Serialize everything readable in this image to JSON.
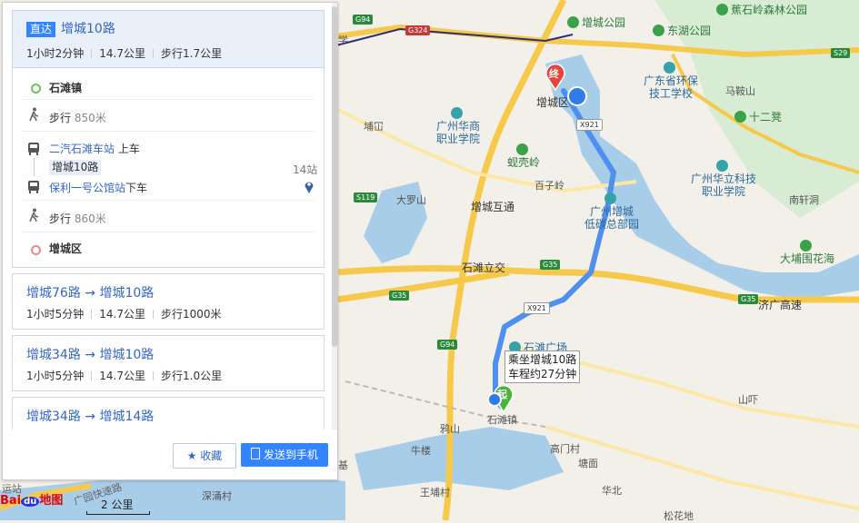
{
  "route_panel": {
    "active_route": {
      "badge": "直达",
      "name": "增城10路",
      "duration": "1小时2分钟",
      "distance": "14.7公里",
      "walk": "步行1.7公里",
      "steps": {
        "origin": "石滩镇",
        "walk1_label": "步行",
        "walk1_dist": "850米",
        "board_stop": "二汽石滩车站",
        "board_action": "上车",
        "line_tag": "增城10路",
        "stop_count": "14站",
        "alight_stop": "保利一号公馆站",
        "alight_action": "下车",
        "walk2_label": "步行",
        "walk2_dist": "860米",
        "destination": "增城区"
      }
    },
    "alternatives": [
      {
        "name": "增城76路 → 增城10路",
        "duration": "1小时5分钟",
        "distance": "14.7公里",
        "walk": "步行1000米"
      },
      {
        "name": "增城34路 → 增城10路",
        "duration": "1小时5分钟",
        "distance": "14.7公里",
        "walk": "步行1.0公里"
      },
      {
        "name": "增城34路 → 增城14路",
        "duration": "",
        "distance": "",
        "walk": ""
      }
    ],
    "buttons": {
      "favorite": "收藏",
      "send_to_phone": "发送到手机"
    }
  },
  "map": {
    "logo": "Bai du 地图",
    "scale_label": "2 公里",
    "route_tooltip": {
      "line1": "乘坐增城10路",
      "line2": "车程约27分钟"
    },
    "start_marker": "起",
    "end_marker": "终",
    "route_color": "#4f8ff0",
    "pois": {
      "forest_park": "蕉石岭森林公园",
      "zengcheng_park": "增城公园",
      "donghu_park": "东湖公园",
      "env_school_1": "广东省环保",
      "env_school_2": "技工学校",
      "huashang_1": "广州华商",
      "huashang_2": "职业学院",
      "xianke": "蚬壳岭",
      "lowcarbon_1": "广州增城",
      "lowcarbon_2": "低碳总部园",
      "huali_1": "广州华立科技",
      "huali_2": "职业学院",
      "shiergeng": "十二凳",
      "dapuwei": "大埔围花海",
      "shitan_square": "石滩广场"
    },
    "labels": {
      "zengcheng_qu": "增城区",
      "mayanshan": "马鞍山",
      "bugang": "埔冚",
      "baiziling": "百子岭",
      "daluoshan": "大罗山",
      "nanxuandong": "南轩洞",
      "zengcheng_interchange": "增城互通",
      "shitan_interchange": "石滩立交",
      "jiguang_expressway": "济广高速",
      "shanpu": "山吓",
      "gangbian": "鸦山",
      "shitan_town": "石滩镇",
      "niulou": "牛楼",
      "gaomencun": "高门村",
      "tangmian": "塘面",
      "wangpucun": "王埔村",
      "shencongcun": "深涌村",
      "huabei": "华北",
      "songcun": "松花地",
      "ji": "基",
      "guangzhou_expressway": "广园快速路",
      "yunzhan": "运站",
      "xue": "学"
    },
    "shields": {
      "g94_top": "G94",
      "g324": "G324",
      "x921_top": "X921",
      "s29": "S29",
      "s119": "S119",
      "g35_mid": "G35",
      "g35_left": "G35",
      "g35_right": "G35",
      "x921_mid": "X921",
      "g94_bottom": "G94"
    }
  }
}
